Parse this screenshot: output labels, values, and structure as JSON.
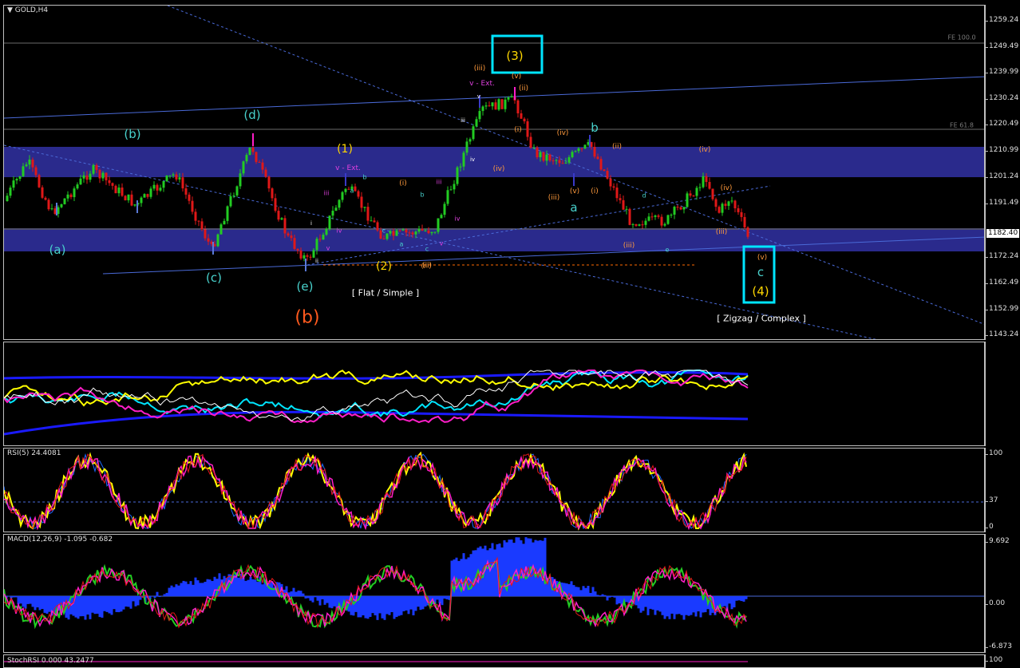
{
  "main": {
    "title": "GOLD,H4",
    "price_ticks": [
      "1259.24",
      "1249.49",
      "1239.99",
      "1230.24",
      "1220.49",
      "1210.99",
      "1201.24",
      "1191.49",
      "1182.40",
      "1172.24",
      "1162.49",
      "1152.99",
      "1143.24"
    ],
    "current_price": "1182.40",
    "fe_labels": [
      "FE 100.0",
      "FE 61.8"
    ],
    "wave_labels": [
      {
        "t": "(a)",
        "c": "#48d1cc"
      },
      {
        "t": "(b)",
        "c": "#48d1cc"
      },
      {
        "t": "(c)",
        "c": "#48d1cc"
      },
      {
        "t": "(d)",
        "c": "#48d1cc"
      },
      {
        "t": "(e)",
        "c": "#48d1cc"
      },
      {
        "t": "(b)",
        "c": "#ff5a1e"
      },
      {
        "t": "(1)",
        "c": "#ffd700"
      },
      {
        "t": "(2)",
        "c": "#ffd700"
      },
      {
        "t": "(3)",
        "c": "#ffd700"
      },
      {
        "t": "(4)",
        "c": "#ffd700"
      },
      {
        "t": "v - Ext.",
        "c": "#e040e0"
      },
      {
        "t": "v - Ext.",
        "c": "#e040e0"
      },
      {
        "t": "[ Flat / Simple ]",
        "c": "#ffffff"
      },
      {
        "t": "[ Zigzag / Complex ]",
        "c": "#ffffff"
      },
      {
        "t": "a",
        "c": "#48d1cc"
      },
      {
        "t": "b",
        "c": "#48d1cc"
      },
      {
        "t": "c",
        "c": "#48d1cc"
      },
      {
        "t": "(iii)",
        "c": "#ff9a3c"
      },
      {
        "t": "(v)",
        "c": "#ff9a3c"
      },
      {
        "t": "(ii)",
        "c": "#ff9a3c"
      },
      {
        "t": "(i)",
        "c": "#ff9a3c"
      },
      {
        "t": "(iv)",
        "c": "#ff9a3c"
      },
      {
        "t": "(iv)",
        "c": "#ff9a3c"
      },
      {
        "t": "(iii)",
        "c": "#ff9a3c"
      },
      {
        "t": "(v)",
        "c": "#ff9a3c"
      },
      {
        "t": "(ii)",
        "c": "#ff9a3c"
      },
      {
        "t": "(i)",
        "c": "#ff9a3c"
      },
      {
        "t": "(iii)",
        "c": "#ff9a3c"
      },
      {
        "t": "(iv)",
        "c": "#ff9a3c"
      },
      {
        "t": "(iv)",
        "c": "#ff9a3c"
      },
      {
        "t": "(iii)",
        "c": "#ff9a3c"
      },
      {
        "t": "(v)",
        "c": "#ff9a3c"
      },
      {
        "t": "(i)",
        "c": "#ff9a3c"
      },
      {
        "t": "(ii)",
        "c": "#ff9a3c"
      },
      {
        "t": "(iii)",
        "c": "#ff9a3c"
      },
      {
        "t": "iii",
        "c": "#e040e0"
      },
      {
        "t": "iv",
        "c": "#e040e0"
      },
      {
        "t": "v",
        "c": "#e040e0"
      },
      {
        "t": "iii",
        "c": "#e040e0"
      },
      {
        "t": "iv",
        "c": "#e040e0"
      },
      {
        "t": "v",
        "c": "#e040e0"
      },
      {
        "t": "i",
        "c": "#ffffff"
      },
      {
        "t": "ii",
        "c": "#ffffff"
      },
      {
        "t": "iii",
        "c": "#ffffff"
      },
      {
        "t": "iv",
        "c": "#ffffff"
      },
      {
        "t": "v",
        "c": "#ffffff"
      },
      {
        "t": "a",
        "c": "#48d1cc"
      },
      {
        "t": "b",
        "c": "#48d1cc"
      },
      {
        "t": "c",
        "c": "#48d1cc"
      },
      {
        "t": "a",
        "c": "#48d1cc"
      },
      {
        "t": "b",
        "c": "#48d1cc"
      },
      {
        "t": "c",
        "c": "#48d1cc"
      },
      {
        "t": "d",
        "c": "#48d1cc"
      },
      {
        "t": "e",
        "c": "#48d1cc"
      }
    ]
  },
  "rsi": {
    "title": "RSI(5) 24.4081",
    "ticks": [
      "100",
      "37",
      "0"
    ],
    "level": "37"
  },
  "macd": {
    "title": "MACD(12,26,9) -1.095 -0.682",
    "ticks": [
      "9.692",
      "0.00",
      "-6.873"
    ]
  },
  "stoch": {
    "title": "StochRSI 0.000 43.2477",
    "tick": "100"
  },
  "colors": {
    "zone": "#2a2a8c",
    "grid": "#6a6a6a",
    "trend": "#4a6ad8",
    "bull": "#22cc22",
    "bear": "#e01818",
    "cyan": "#00e5ff",
    "yellow": "#ffff00",
    "magenta": "#ff1ec8"
  }
}
